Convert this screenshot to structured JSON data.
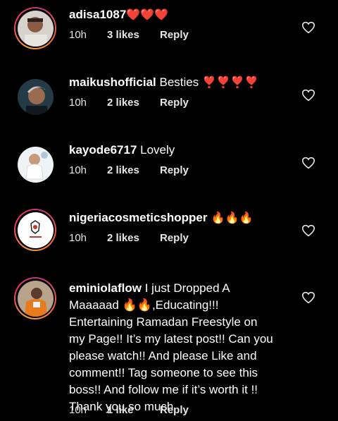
{
  "comments": [
    {
      "username": "adisa1087",
      "text": "",
      "emoji": "❤️❤️❤️",
      "time": "10h",
      "likes": "3 likes",
      "reply": "Reply",
      "avatar": "avatar-photo-person"
    },
    {
      "username": "maikushofficial",
      "text": " Besties",
      "emoji": " ❣️❣️❣️❣️",
      "time": "10h",
      "likes": "2 likes",
      "reply": "Reply",
      "avatar": "avatar-photo-person"
    },
    {
      "username": "kayode6717",
      "text": " Lovely",
      "emoji": "",
      "time": "10h",
      "likes": "2 likes",
      "reply": "Reply",
      "avatar": "avatar-photo-baby"
    },
    {
      "username": "nigeriacosmeticshopper",
      "text": "",
      "emoji": " 🔥🔥🔥",
      "time": "10h",
      "likes": "2 likes",
      "reply": "Reply",
      "avatar": "avatar-logo"
    },
    {
      "username": "eminiolaflow",
      "text_lines": [
        " I just Dropped A",
        "Maaaaad 🔥🔥,Educating!!!",
        "Entertaining Ramadan Freestyle on",
        "my Page!! It’s my latest post!! Can you",
        "please watch!! And please Like and",
        "comment!! Tag someone to see this",
        "boss!! And follow me if it’s worth it !!",
        "Thank you so much"
      ],
      "time": "10h",
      "likes": "1 like",
      "reply": "Reply",
      "avatar": "avatar-photo-person"
    }
  ],
  "icons": {
    "like": "heart-outline-icon"
  },
  "colors": {
    "ring_start": "#f9a43a",
    "ring_mid": "#e8365d",
    "ring_end": "#c13584",
    "background": "#000000"
  }
}
